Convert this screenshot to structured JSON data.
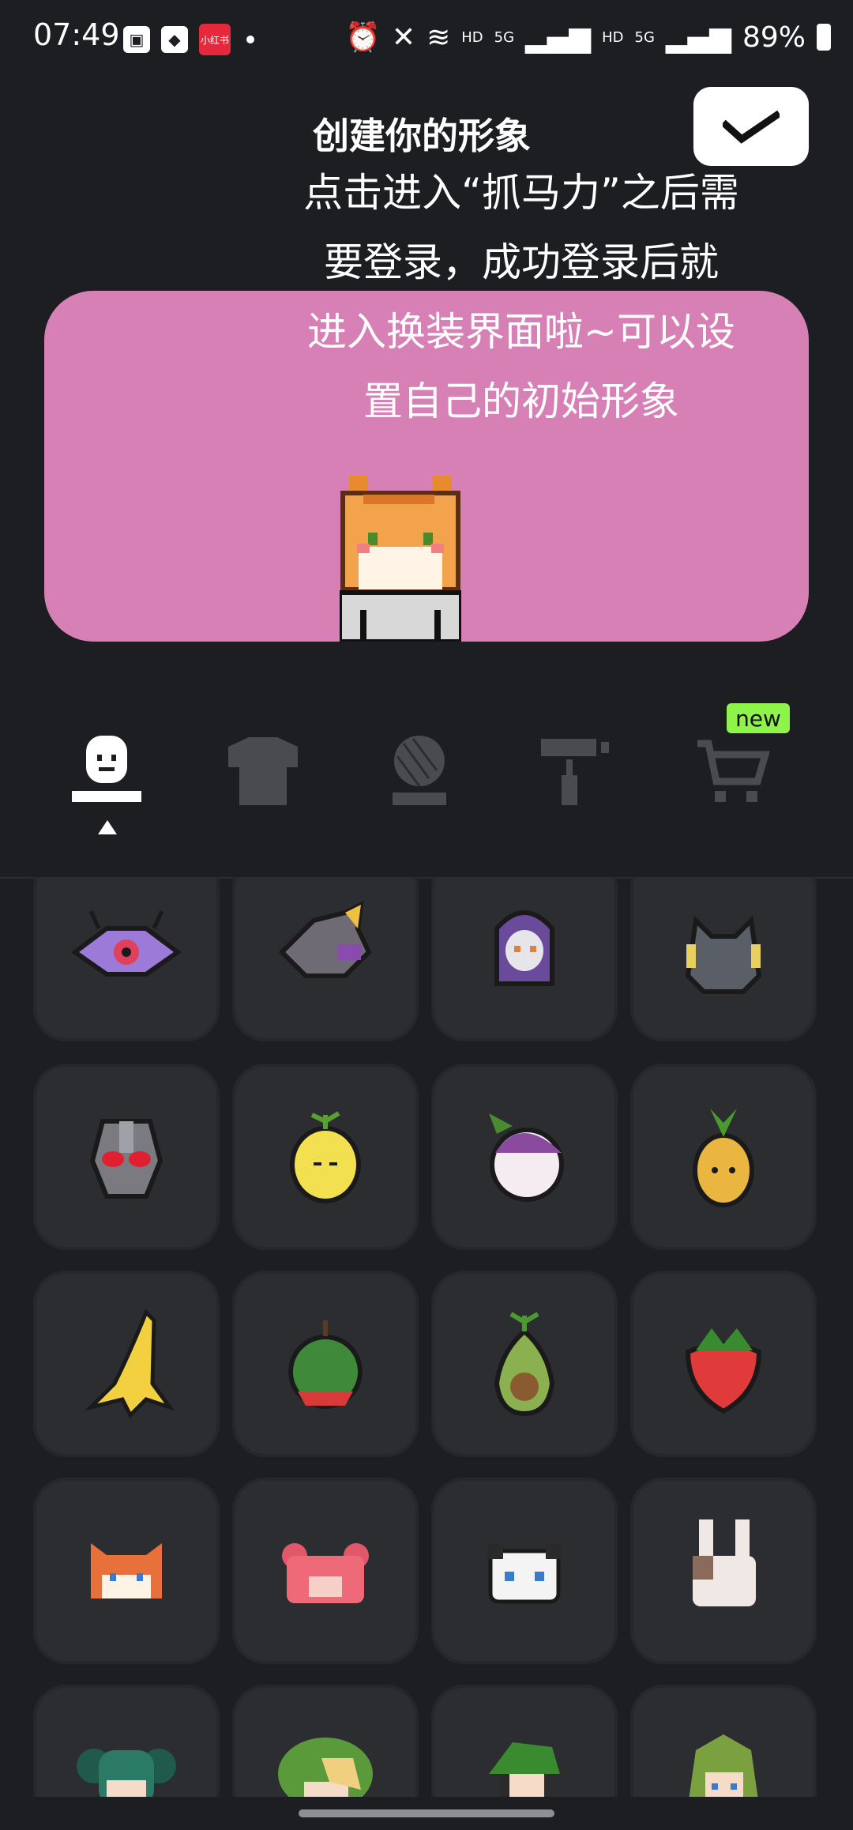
{
  "status": {
    "time": "07:49",
    "right_hd1": "HD",
    "right_5g1": "5G",
    "right_hd2": "HD",
    "right_5g2": "5G",
    "battery": "89%",
    "app_icon_text": "小红书"
  },
  "header": {
    "title": "创建你的形象",
    "confirm_icon": "check-icon"
  },
  "preview": {
    "background": "#d780b6",
    "caption_lines": [
      "点击进入“抓马力”之后需",
      "要登录，成功登录后就",
      "进入换装界面啦~可以设",
      "置自己的初始形象"
    ]
  },
  "tabs": {
    "items": [
      {
        "name": "face",
        "icon": "face-icon",
        "active": true
      },
      {
        "name": "clothes",
        "icon": "shirt-icon",
        "active": false
      },
      {
        "name": "hair",
        "icon": "head-mesh-icon",
        "active": false
      },
      {
        "name": "paint",
        "icon": "paint-roller-icon",
        "active": false
      },
      {
        "name": "shop",
        "icon": "cart-icon",
        "active": false
      }
    ],
    "new_badge": "new"
  },
  "grid": {
    "items": [
      {
        "icon": "ufo-eye-icon"
      },
      {
        "icon": "shark-icon"
      },
      {
        "icon": "ghost-hood-icon"
      },
      {
        "icon": "helmet-icon"
      },
      {
        "icon": "red-eye-mask-icon"
      },
      {
        "icon": "lemon-icon"
      },
      {
        "icon": "turnip-icon"
      },
      {
        "icon": "pineapple-icon"
      },
      {
        "icon": "banana-icon"
      },
      {
        "icon": "watermelon-icon"
      },
      {
        "icon": "avocado-icon"
      },
      {
        "icon": "strawberry-icon"
      },
      {
        "icon": "fox-icon"
      },
      {
        "icon": "bear-icon"
      },
      {
        "icon": "panda-icon"
      },
      {
        "icon": "bunny-icon"
      },
      {
        "icon": "twintail-girl-icon"
      },
      {
        "icon": "bush-hair-icon"
      },
      {
        "icon": "leaf-hat-icon"
      },
      {
        "icon": "plant-girl-icon"
      }
    ]
  }
}
